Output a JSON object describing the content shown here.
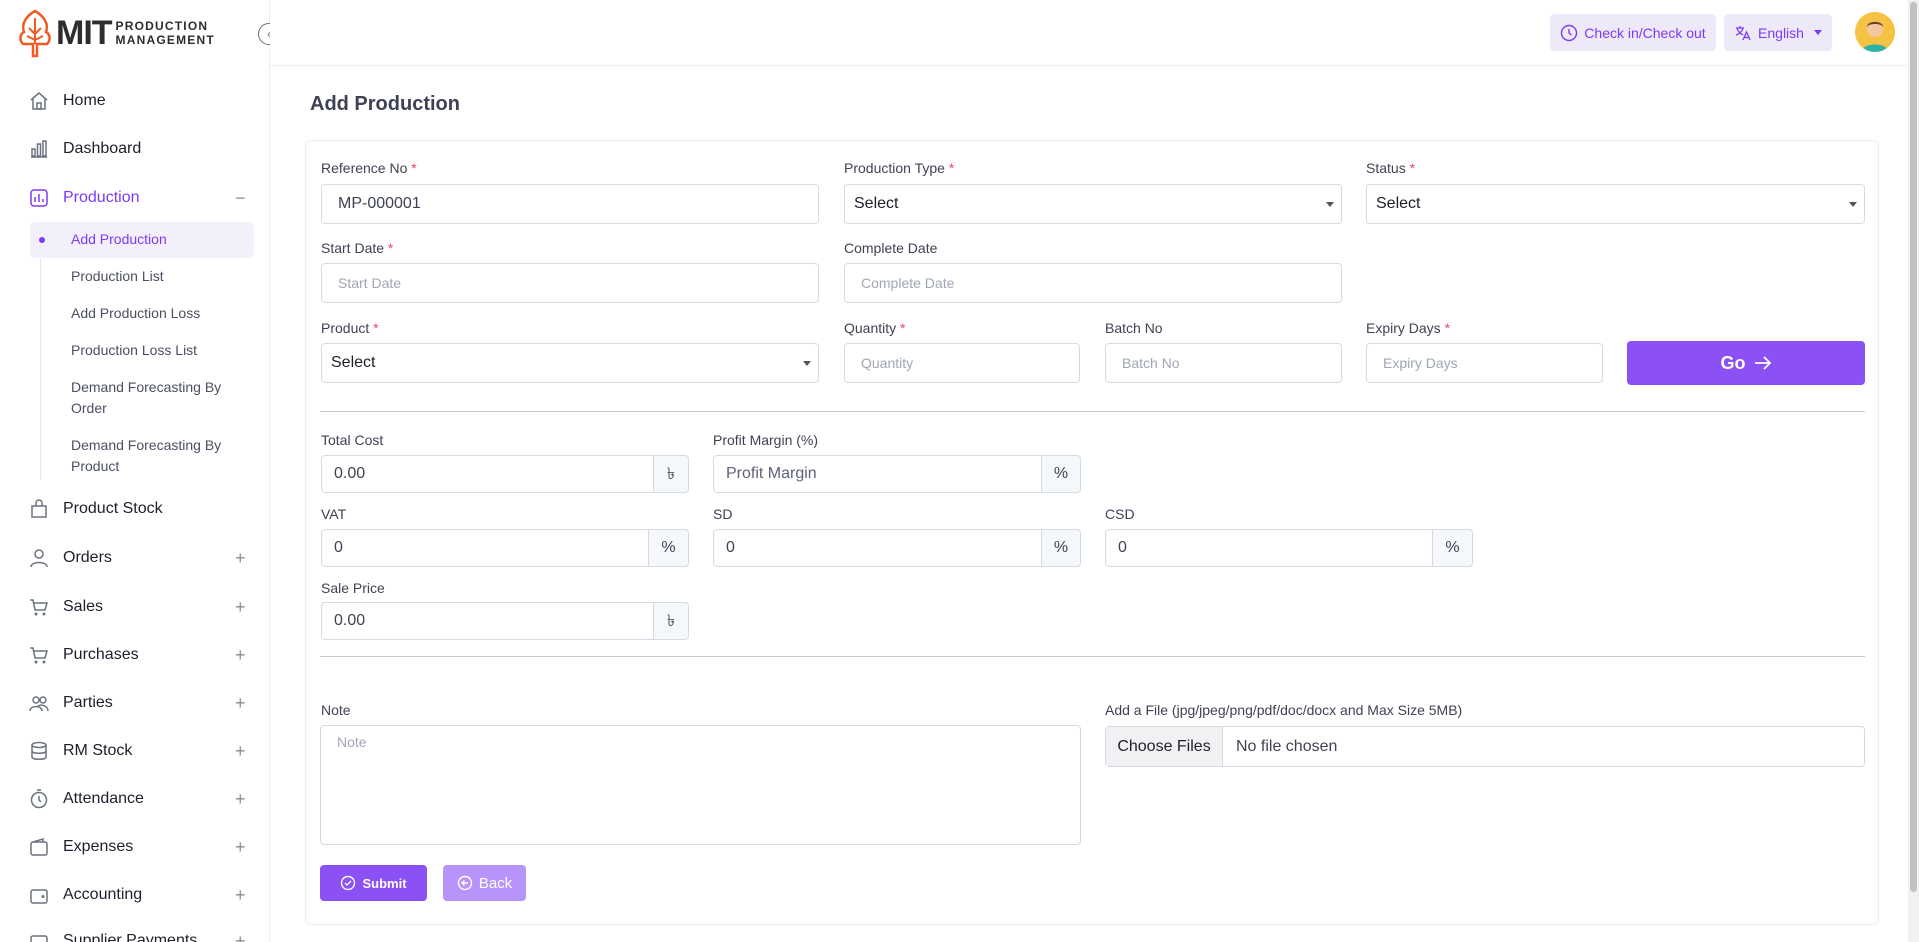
{
  "brand": {
    "name": "MIT",
    "sub_line1": "PRODUCTION",
    "sub_line2": "MANAGEMENT"
  },
  "header": {
    "checkin_label": "Check in/Check out",
    "language_label": "English"
  },
  "sidebar": {
    "items": [
      {
        "label": "Home",
        "icon": "home-icon"
      },
      {
        "label": "Dashboard",
        "icon": "dashboard-icon"
      },
      {
        "label": "Production",
        "icon": "production-icon",
        "expanded": true
      },
      {
        "label": "Product Stock",
        "icon": "stock-icon"
      },
      {
        "label": "Orders",
        "icon": "user-icon"
      },
      {
        "label": "Sales",
        "icon": "cart-icon"
      },
      {
        "label": "Purchases",
        "icon": "cart-icon"
      },
      {
        "label": "Parties",
        "icon": "users-icon"
      },
      {
        "label": "RM Stock",
        "icon": "database-icon"
      },
      {
        "label": "Attendance",
        "icon": "clock-icon"
      },
      {
        "label": "Expenses",
        "icon": "wallet-icon"
      },
      {
        "label": "Accounting",
        "icon": "wallet-icon"
      },
      {
        "label": "Supplier Payments",
        "icon": "payment-icon"
      }
    ],
    "production_sub": [
      {
        "label": "Add Production",
        "active": true
      },
      {
        "label": "Production List"
      },
      {
        "label": "Add Production Loss"
      },
      {
        "label": "Production Loss List"
      },
      {
        "label": "Demand Forecasting By Order"
      },
      {
        "label": "Demand Forecasting By Product"
      }
    ]
  },
  "page": {
    "title": "Add Production"
  },
  "form": {
    "reference_no": {
      "label": "Reference No",
      "value": "MP-000001"
    },
    "production_type": {
      "label": "Production Type",
      "value": "Select"
    },
    "status": {
      "label": "Status",
      "value": "Select"
    },
    "start_date": {
      "label": "Start Date",
      "placeholder": "Start Date"
    },
    "complete_date": {
      "label": "Complete Date",
      "placeholder": "Complete Date"
    },
    "product": {
      "label": "Product",
      "value": "Select"
    },
    "quantity": {
      "label": "Quantity",
      "placeholder": "Quantity"
    },
    "batch_no": {
      "label": "Batch No",
      "placeholder": "Batch No"
    },
    "expiry_days": {
      "label": "Expiry Days",
      "placeholder": "Expiry Days"
    },
    "go_label": "Go",
    "total_cost": {
      "label": "Total Cost",
      "value": "0.00",
      "unit": "৳"
    },
    "profit_margin": {
      "label": "Profit Margin (%)",
      "placeholder": "Profit Margin",
      "unit": "%"
    },
    "vat": {
      "label": "VAT",
      "value": "0",
      "unit": "%"
    },
    "sd": {
      "label": "SD",
      "value": "0",
      "unit": "%"
    },
    "csd": {
      "label": "CSD",
      "value": "0",
      "unit": "%"
    },
    "sale_price": {
      "label": "Sale Price",
      "value": "0.00",
      "unit": "৳"
    },
    "note": {
      "label": "Note",
      "placeholder": "Note"
    },
    "file": {
      "label": "Add a File (jpg/jpeg/png/pdf/doc/docx and Max Size 5MB)",
      "button": "Choose Files",
      "status": "No file chosen"
    },
    "submit_label": "Submit",
    "back_label": "Back",
    "required_mark": "*"
  },
  "colors": {
    "accent": "#8b51f5",
    "accent_light": "#ede9f8",
    "required": "#f1416c"
  }
}
